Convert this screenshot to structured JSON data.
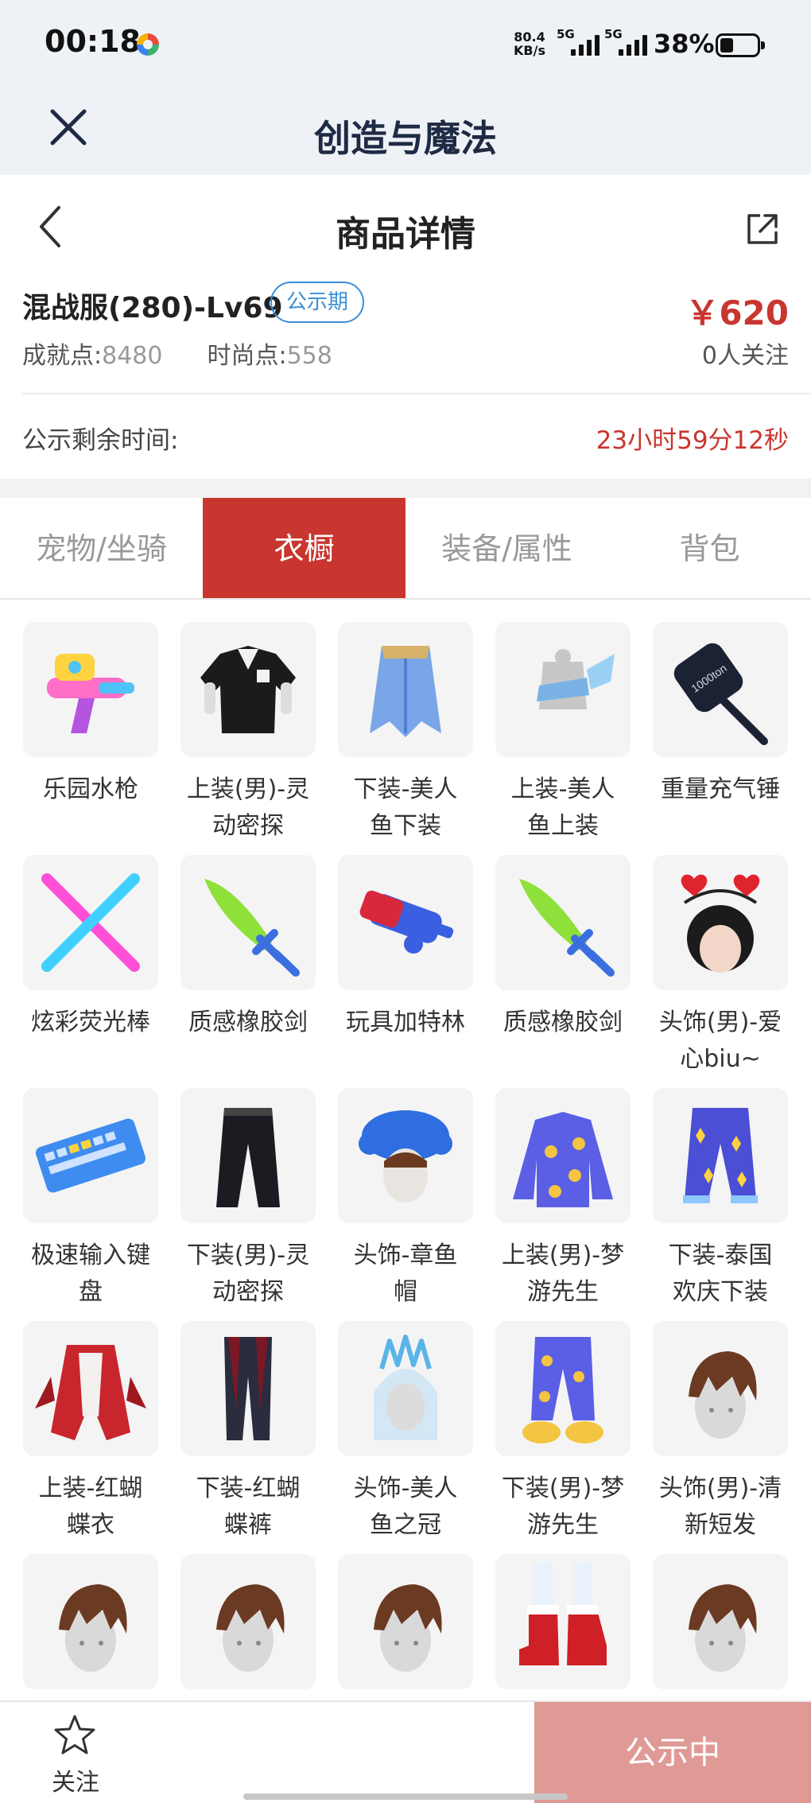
{
  "status_bar": {
    "time": "00:18",
    "net_speed_value": "80.4",
    "net_speed_unit": "KB/s",
    "sim1": "5G",
    "sim2": "5G",
    "battery": "38%"
  },
  "app_header": {
    "title": "创造与魔法"
  },
  "page_nav": {
    "title": "商品详情"
  },
  "product": {
    "name": "混战服(280)-Lv69",
    "badge": "公示期",
    "price": "￥620",
    "achievement_label": "成就点:",
    "achievement_value": "8480",
    "fashion_label": "时尚点:",
    "fashion_value": "558",
    "followers": "0人关注"
  },
  "countdown": {
    "label": "公示剩余时间:",
    "value": "23小时59分12秒"
  },
  "tabs": [
    {
      "label": "宠物/坐骑",
      "active": false
    },
    {
      "label": "衣橱",
      "active": true
    },
    {
      "label": "装备/属性",
      "active": false
    },
    {
      "label": "背包",
      "active": false
    }
  ],
  "wardrobe_items": [
    {
      "line1": "乐园水枪",
      "line2": "",
      "icon": "water-gun-icon"
    },
    {
      "line1": "上装(男)-灵",
      "line2": "动密探",
      "icon": "jacket-icon"
    },
    {
      "line1": "下装-美人",
      "line2": "鱼下装",
      "icon": "mermaid-skirt-icon"
    },
    {
      "line1": "上装-美人",
      "line2": "鱼上装",
      "icon": "mermaid-top-icon"
    },
    {
      "line1": "重量充气锤",
      "line2": "",
      "icon": "hammer-icon"
    },
    {
      "line1": "炫彩荧光棒",
      "line2": "",
      "icon": "glow-sticks-icon"
    },
    {
      "line1": "质感橡胶剑",
      "line2": "",
      "icon": "rubber-sword-icon"
    },
    {
      "line1": "玩具加特林",
      "line2": "",
      "icon": "toy-gatling-icon"
    },
    {
      "line1": "质感橡胶剑",
      "line2": "",
      "icon": "rubber-sword-icon"
    },
    {
      "line1": "头饰(男)-爱",
      "line2": "心biu~",
      "icon": "heart-headband-icon"
    },
    {
      "line1": "极速输入键",
      "line2": "盘",
      "icon": "keyboard-icon"
    },
    {
      "line1": "下装(男)-灵",
      "line2": "动密探",
      "icon": "trousers-icon"
    },
    {
      "line1": "头饰-章鱼",
      "line2": "帽",
      "icon": "octopus-hat-icon"
    },
    {
      "line1": "上装(男)-梦",
      "line2": "游先生",
      "icon": "pajama-top-icon"
    },
    {
      "line1": "下装-泰国",
      "line2": "欢庆下装",
      "icon": "thai-pants-icon"
    },
    {
      "line1": "上装-红蝴",
      "line2": "蝶衣",
      "icon": "red-butterfly-top-icon"
    },
    {
      "line1": "下装-红蝴",
      "line2": "蝶裤",
      "icon": "red-butterfly-pants-icon"
    },
    {
      "line1": "头饰-美人",
      "line2": "鱼之冠",
      "icon": "mermaid-crown-icon"
    },
    {
      "line1": "下装(男)-梦",
      "line2": "游先生",
      "icon": "pajama-pants-icon"
    },
    {
      "line1": "头饰(男)-清",
      "line2": "新短发",
      "icon": "short-hair-icon"
    },
    {
      "line1": "",
      "line2": "",
      "icon": "short-hair-icon"
    },
    {
      "line1": "",
      "line2": "",
      "icon": "short-hair-icon"
    },
    {
      "line1": "",
      "line2": "",
      "icon": "short-hair-icon"
    },
    {
      "line1": "",
      "line2": "",
      "icon": "red-boots-icon"
    },
    {
      "line1": "",
      "line2": "",
      "icon": "short-hair-icon"
    }
  ],
  "bottom_bar": {
    "follow_label": "关注",
    "status_label": "公示中"
  },
  "colors": {
    "accent_red": "#c8362f",
    "badge_blue": "#3c8fd6",
    "status_button": "#e09a96"
  }
}
